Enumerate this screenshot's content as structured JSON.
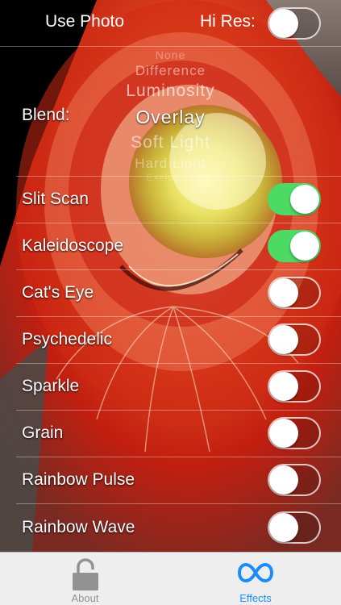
{
  "header": {
    "use_photo": "Use Photo",
    "hi_res_label": "Hi Res:",
    "hi_res_on": false
  },
  "blend": {
    "label": "Blend:",
    "options": [
      "None",
      "Difference",
      "Luminosity",
      "Overlay",
      "Soft Light",
      "Hard Light",
      "Exclusion"
    ],
    "selected": "Overlay"
  },
  "effects": [
    {
      "label": "Slit Scan",
      "on": true
    },
    {
      "label": "Kaleidoscope",
      "on": true
    },
    {
      "label": "Cat's Eye",
      "on": false
    },
    {
      "label": "Psychedelic",
      "on": false
    },
    {
      "label": "Sparkle",
      "on": false
    },
    {
      "label": "Grain",
      "on": false
    },
    {
      "label": "Rainbow Pulse",
      "on": false
    },
    {
      "label": "Rainbow Wave",
      "on": false
    }
  ],
  "tabbar": {
    "about_label": "About",
    "effects_label": "Effects",
    "about_icon": "lock-icon",
    "effects_icon": "infinity-icon",
    "active": "Effects"
  },
  "colors": {
    "switch_on": "#4cd964",
    "tab_active": "#1a8cff",
    "tab_inactive": "#929292"
  }
}
